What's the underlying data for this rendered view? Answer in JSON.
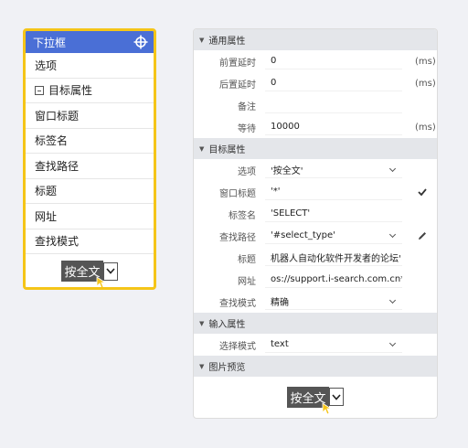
{
  "dropdown_card": {
    "title": "下拉框",
    "items": [
      "选项",
      "目标属性",
      "窗口标题",
      "标签名",
      "查找路径",
      "标题",
      "网址",
      "查找模式"
    ],
    "preview_text": "按全文"
  },
  "panel": {
    "general": {
      "header": "通用属性",
      "pre_delay_label": "前置延时",
      "pre_delay_value": "0",
      "pre_delay_unit": "(ms)",
      "post_delay_label": "后置延时",
      "post_delay_value": "0",
      "post_delay_unit": "(ms)",
      "note_label": "备注",
      "note_value": "",
      "wait_label": "等待",
      "wait_value": "10000",
      "wait_unit": "(ms)"
    },
    "target": {
      "header": "目标属性",
      "option_label": "选项",
      "option_value": "'按全文'",
      "window_title_label": "窗口标题",
      "window_title_value": "'*'",
      "tag_label": "标签名",
      "tag_value": "'SELECT'",
      "path_label": "查找路径",
      "path_value": "'#select_type'",
      "title_label": "标题",
      "title_value": "机器人自动化软件开发者的论坛'",
      "url_label": "网址",
      "url_value": "os://support.i-search.com.cn*'",
      "mode_label": "查找模式",
      "mode_value": "精确"
    },
    "input": {
      "header": "输入属性",
      "select_mode_label": "选择模式",
      "select_mode_value": "text"
    },
    "image": {
      "header": "图片预览",
      "preview_text": "按全文"
    }
  },
  "colors": {
    "accent": "#4a6fd6",
    "highlight_border": "#f5c518"
  }
}
